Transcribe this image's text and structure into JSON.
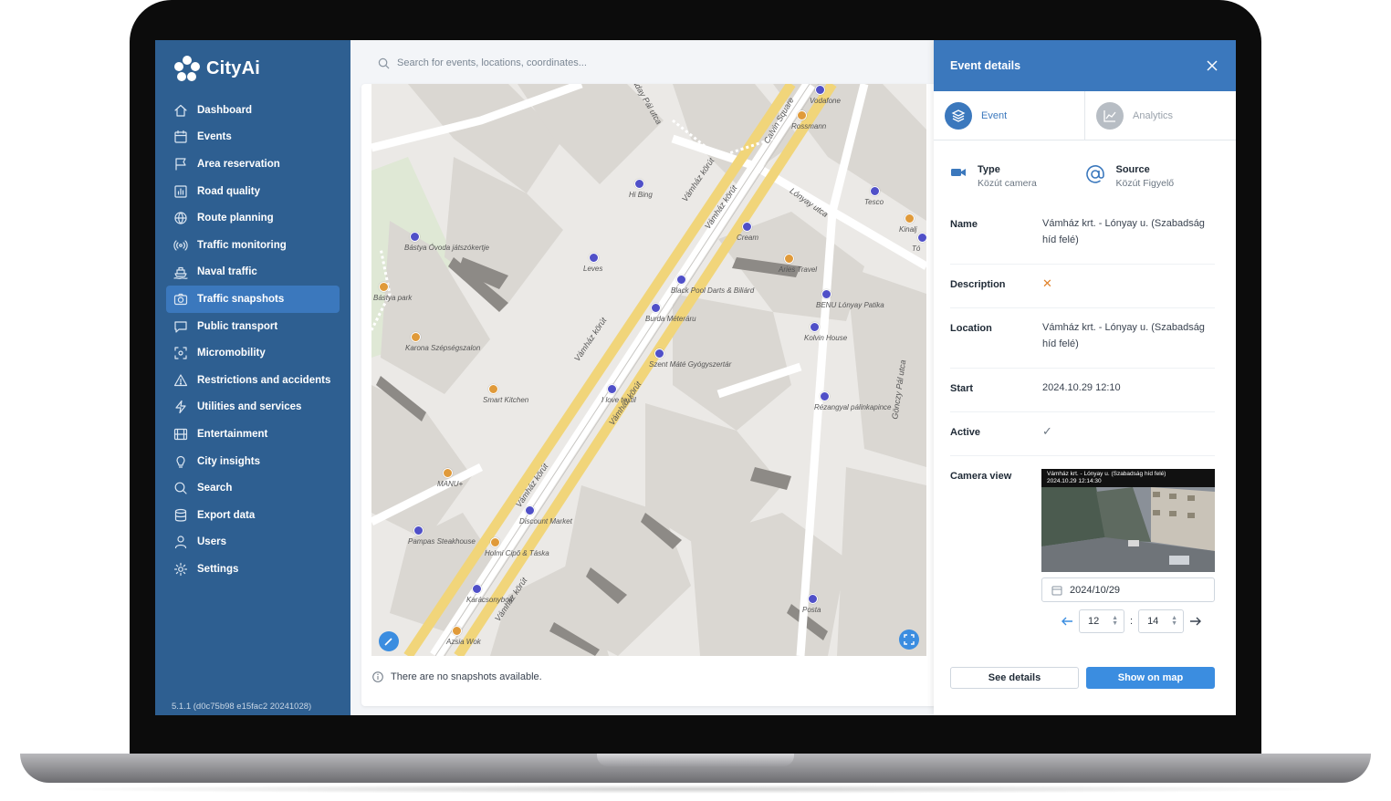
{
  "app": {
    "name": "CityAi",
    "version": "5.1.1 (d0c75b98 e15fac2 20241028)"
  },
  "sidebar": {
    "items": [
      {
        "label": "Dashboard",
        "icon": "home-icon"
      },
      {
        "label": "Events",
        "icon": "calendar-icon"
      },
      {
        "label": "Area reservation",
        "icon": "flag-icon"
      },
      {
        "label": "Road quality",
        "icon": "bar-chart-icon"
      },
      {
        "label": "Route planning",
        "icon": "globe-icon"
      },
      {
        "label": "Traffic monitoring",
        "icon": "broadcast-icon"
      },
      {
        "label": "Naval traffic",
        "icon": "ship-icon"
      },
      {
        "label": "Traffic snapshots",
        "icon": "camera-icon",
        "active": true
      },
      {
        "label": "Public transport",
        "icon": "message-icon"
      },
      {
        "label": "Micromobility",
        "icon": "scan-icon"
      },
      {
        "label": "Restrictions and accidents",
        "icon": "warning-icon"
      },
      {
        "label": "Utilities and services",
        "icon": "bolt-icon"
      },
      {
        "label": "Entertainment",
        "icon": "film-icon"
      },
      {
        "label": "City insights",
        "icon": "lightbulb-icon"
      },
      {
        "label": "Search",
        "icon": "search-icon"
      },
      {
        "label": "Export data",
        "icon": "database-icon"
      },
      {
        "label": "Users",
        "icon": "user-icon"
      },
      {
        "label": "Settings",
        "icon": "gear-icon"
      }
    ]
  },
  "search": {
    "placeholder": "Search for events, locations, coordinates..."
  },
  "map": {
    "streets": [
      "Vámház körút",
      "Vámház körút",
      "Vámház körút",
      "Vámház körút",
      "Vámház körút",
      "Vámház körút",
      "Calvin Square",
      "Lónyay utca",
      "Gönczy Pál utca",
      "Ráday Pál utca"
    ],
    "pois": [
      "Vodafone",
      "Rossmann",
      "Hi Bing",
      "Tesco",
      "Kinalj",
      "Bástya Óvoda játszókertje",
      "Bástya park",
      "Leves",
      "Cream",
      "Aries Travel",
      "Black Pool Darts & Biliárd",
      "BENU Lónyay Patika",
      "Burda Méteráru",
      "Karona Szépségszalon",
      "Kolvin House",
      "Szent Máté Gyógyszertár",
      "Smart Kitchen",
      "I love textil",
      "Rézangyal pálinkapince",
      "MANU+",
      "Discount Market",
      "Pampas Steakhouse",
      "Holmi Cipő & Táska",
      "Karácsonybolt",
      "Azsia Wok",
      "Posta",
      "Tó"
    ]
  },
  "snapshots": {
    "empty_text": "There are no snapshots available."
  },
  "panel": {
    "title": "Event details",
    "tabs": [
      {
        "label": "Event",
        "icon": "layers-icon"
      },
      {
        "label": "Analytics",
        "icon": "trend-icon"
      }
    ],
    "type": {
      "label": "Type",
      "value": "Közút camera"
    },
    "source": {
      "label": "Source",
      "value": "Közút Figyelő"
    },
    "fields": [
      {
        "label": "Name",
        "value": "Vámház krt. - Lónyay u. (Szabadság híd felé)"
      },
      {
        "label": "Description",
        "value": "✕"
      },
      {
        "label": "Location",
        "value": "Vámház krt. - Lónyay u. (Szabadság híd felé)"
      },
      {
        "label": "Start",
        "value": "2024.10.29 12:10"
      },
      {
        "label": "Active",
        "value": "✓"
      },
      {
        "label": "Camera view",
        "value": ""
      }
    ],
    "camera_overlay": {
      "line1": "Vámház krt. - Lónyay u. (Szabadság híd felé)",
      "line2": "2024.10.29  12:14:30"
    },
    "date": "2024/10/29",
    "hour": "12",
    "minute": "14",
    "buttons": {
      "details": "See details",
      "map": "Show on map"
    }
  },
  "colors": {
    "sidebar": "#2e5f91",
    "accent": "#3b78bd",
    "primary_button": "#3b8de0"
  }
}
